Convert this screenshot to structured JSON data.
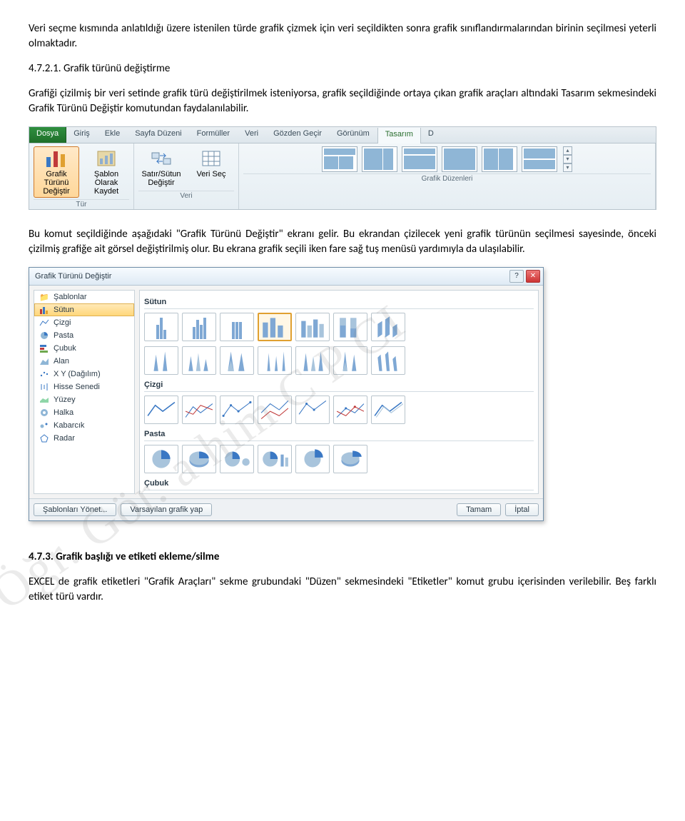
{
  "paragraphs": {
    "intro": "Veri seçme kısmında anlatıldığı üzere istenilen türde grafik çizmek için veri seçildikten sonra grafik sınıflandırmalarından birinin seçilmesi yeterli olmaktadır.",
    "sec1_num": "4.7.2.1. Grafik türünü değiştirme",
    "sec1_body": "Grafiği çizilmiş bir veri setinde grafik türü değiştirilmek isteniyorsa, grafik seçildiğinde ortaya çıkan grafik araçları altındaki Tasarım sekmesindeki Grafik Türünü Değiştir komutundan faydalanılabilir.",
    "mid": "Bu komut seçildiğinde aşağıdaki \"Grafik Türünü Değiştir\" ekranı gelir. Bu ekrandan çizilecek yeni grafik türünün seçilmesi sayesinde, önceki çizilmiş grafiğe ait görsel değiştirilmiş olur. Bu ekrana grafik seçili iken fare sağ tuş menüsü yardımıyla da ulaşılabilir.",
    "sec2_num": "4.7.3. Grafik başlığı ve etiketi ekleme/silme",
    "sec2_body": "EXCEL de grafik etiketleri \"Grafik Araçları\" sekme grubundaki \"Düzen\" sekmesindeki \"Etiketler\" komut grubu içerisinden verilebilir. Beş farklı etiket türü vardır."
  },
  "ribbon": {
    "tabs": [
      "Dosya",
      "Giriş",
      "Ekle",
      "Sayfa Düzeni",
      "Formüller",
      "Veri",
      "Gözden Geçir",
      "Görünüm",
      "Tasarım",
      "D"
    ],
    "buttons": {
      "change_type": "Grafik Türünü Değiştir",
      "save_template": "Şablon Olarak Kaydet",
      "switch_rowcol": "Satır/Sütun Değiştir",
      "select_data": "Veri Seç"
    },
    "groups": {
      "type": "Tür",
      "data": "Veri",
      "layouts": "Grafik Düzenleri"
    }
  },
  "dialog": {
    "title": "Grafik Türünü Değiştir",
    "side": [
      "Şablonlar",
      "Sütun",
      "Çizgi",
      "Pasta",
      "Çubuk",
      "Alan",
      "X Y (Dağılım)",
      "Hisse Senedi",
      "Yüzey",
      "Halka",
      "Kabarcık",
      "Radar"
    ],
    "selected_side": "Sütun",
    "categories": [
      "Sütun",
      "Çizgi",
      "Pasta",
      "Çubuk"
    ],
    "footer": {
      "manage": "Şablonları Yönet...",
      "default": "Varsayılan grafik yap",
      "ok": "Tamam",
      "cancel": "İptal"
    }
  },
  "watermark": "Öğr. Gör.    a    him C  P  CI"
}
